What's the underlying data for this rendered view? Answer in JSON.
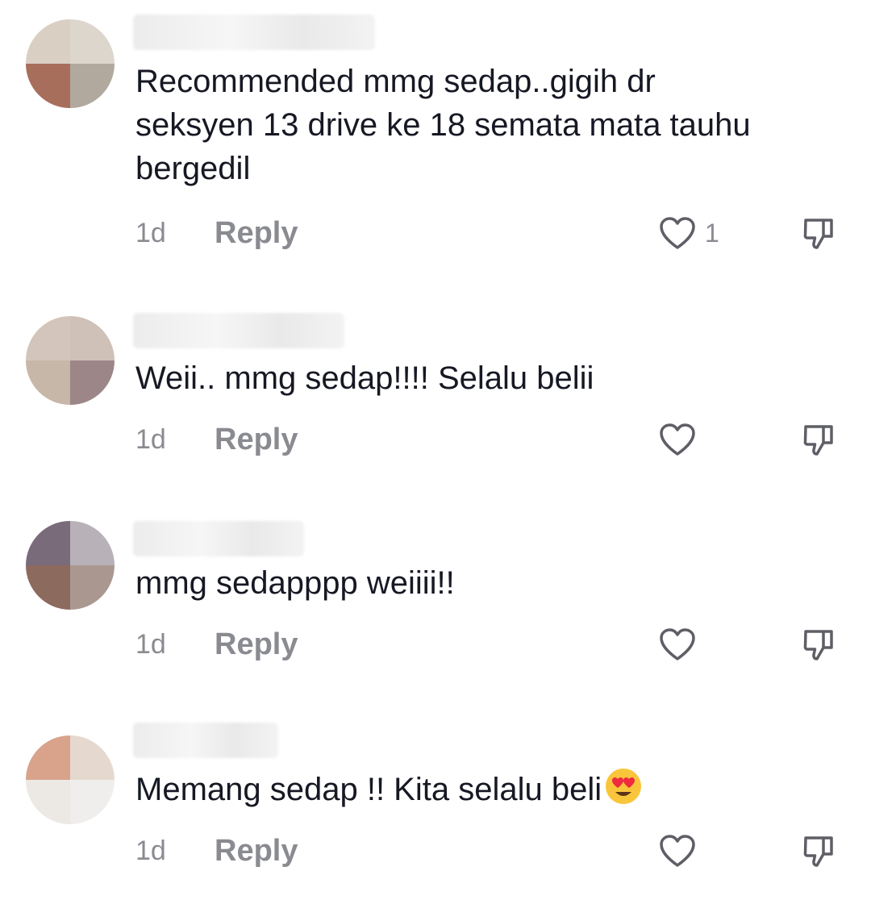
{
  "comments": [
    {
      "text": "Recommended mmg sedap..gigih dr seksyen 13 drive ke 18 semata mata tauhu bergedil",
      "time": "1d",
      "reply_label": "Reply",
      "like_count": "1",
      "avatar_colors": [
        "#d9cfc3",
        "#ddd6cd",
        "#a86e5c",
        "#b1a99e"
      ]
    },
    {
      "text": "Weii.. mmg sedap!!!! Selalu belii",
      "time": "1d",
      "reply_label": "Reply",
      "like_count": "",
      "avatar_colors": [
        "#d3c5bb",
        "#cfc1b8",
        "#c6b7a9",
        "#9c8687"
      ]
    },
    {
      "text": "mmg sedapppp weiiii!!",
      "time": "1d",
      "reply_label": "Reply",
      "like_count": "",
      "avatar_colors": [
        "#7a6b7a",
        "#b9b1b8",
        "#8c6a5e",
        "#aa9890"
      ]
    },
    {
      "text": "Memang sedap !! Kita selalu beli",
      "emoji": "heart-eyes-emoji",
      "time": "1d",
      "reply_label": "Reply",
      "like_count": "",
      "avatar_colors": [
        "#d8a28b",
        "#e5d9cf",
        "#ece8e4",
        "#f0eeec"
      ]
    }
  ],
  "colors": {
    "text": "#161823",
    "secondary": "#8a8b91",
    "icon": "#5e5f66"
  }
}
